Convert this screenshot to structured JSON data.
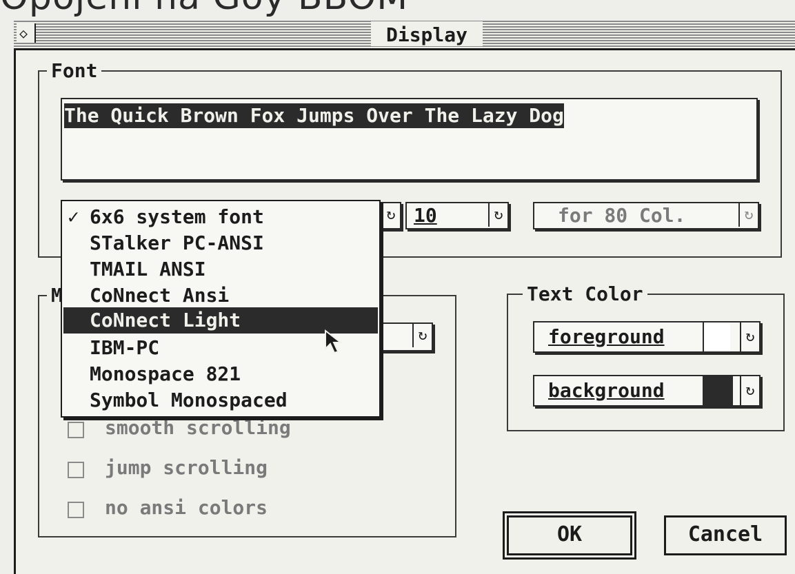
{
  "window": {
    "caption_fragment": "Opojení na Goy BBOM",
    "title": "Display"
  },
  "font_group": {
    "label": "Font",
    "sample_text": "The Quick Brown Fox Jumps Over The Lazy Dog",
    "size_value": "10",
    "columns_value": "for 80 Col."
  },
  "font_menu": {
    "items": [
      {
        "label": "6x6 system font",
        "checked": true
      },
      {
        "label": "STalker PC-ANSI"
      },
      {
        "label": "TMAIL ANSI"
      },
      {
        "label": "CoNnect Ansi"
      },
      {
        "label": "CoNnect Light",
        "highlighted": true
      },
      {
        "label": "IBM-PC"
      },
      {
        "label": "Monospace 821"
      },
      {
        "label": "Symbol Monospaced"
      }
    ],
    "check_mark": "✓"
  },
  "misc_group": {
    "label_partial": "M",
    "options": [
      {
        "label": "smooth scrolling",
        "checked": false
      },
      {
        "label": "jump scrolling",
        "checked": false
      },
      {
        "label": "no ansi colors",
        "checked": false
      }
    ]
  },
  "text_color_group": {
    "label": "Text Color",
    "foreground_label": "foreground",
    "background_label": "background",
    "foreground_swatch": "#ffffff",
    "background_swatch": "#2b2b2b"
  },
  "buttons": {
    "ok": "OK",
    "cancel": "Cancel"
  },
  "icons": {
    "close": "◇",
    "cycle": "↻",
    "pointer": "➤"
  }
}
